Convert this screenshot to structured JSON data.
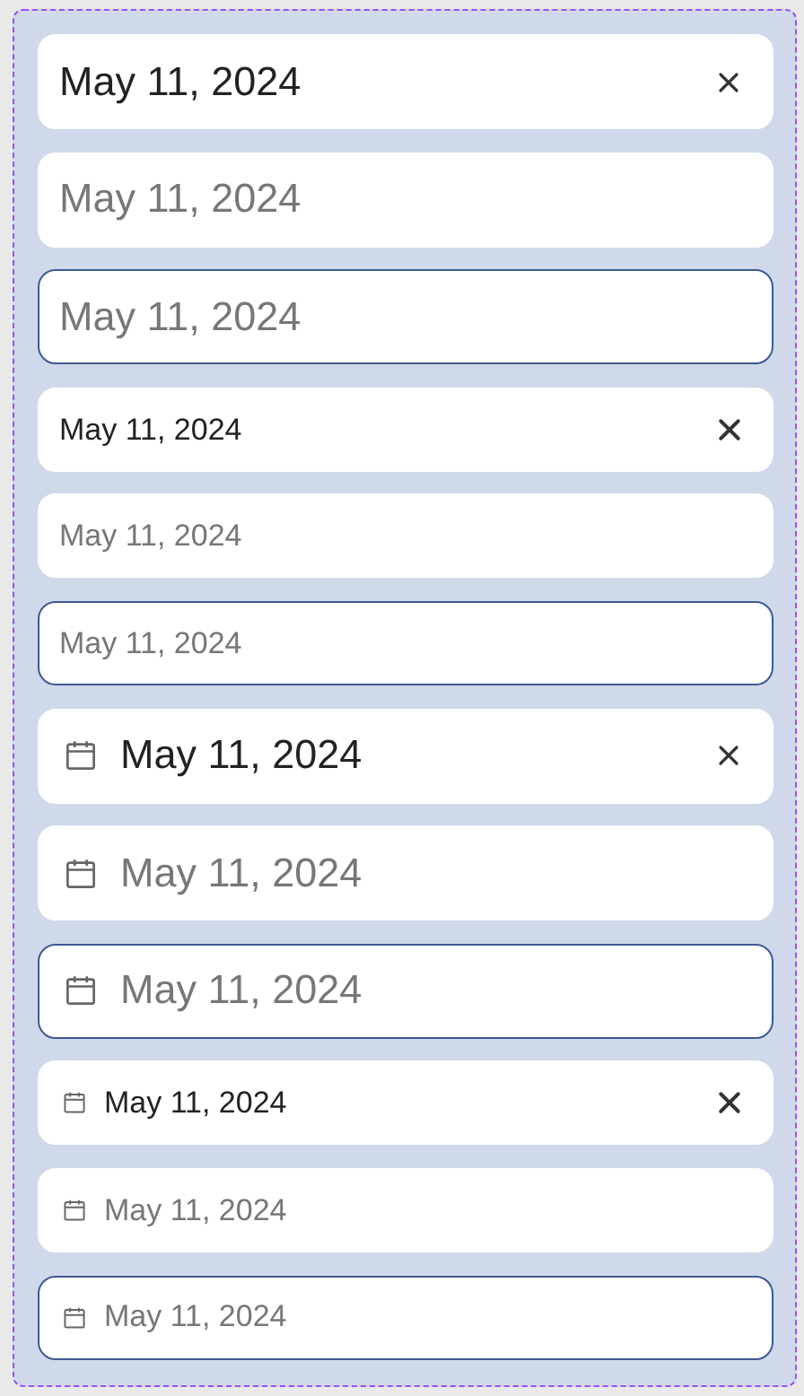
{
  "fields": [
    {
      "kind": "large",
      "icon": false,
      "value": "May 11, 2024",
      "focused": false
    },
    {
      "kind": "large",
      "icon": false,
      "placeholder": "May 11, 2024",
      "focused": false
    },
    {
      "kind": "large",
      "icon": false,
      "placeholder": "May 11, 2024",
      "focused": true
    },
    {
      "kind": "small",
      "icon": false,
      "value": "May 11, 2024",
      "focused": false
    },
    {
      "kind": "small",
      "icon": false,
      "placeholder": "May 11, 2024",
      "focused": false
    },
    {
      "kind": "small",
      "icon": false,
      "placeholder": "May 11, 2024",
      "focused": true
    },
    {
      "kind": "large",
      "icon": true,
      "value": "May 11, 2024",
      "focused": false
    },
    {
      "kind": "large",
      "icon": true,
      "placeholder": "May 11, 2024",
      "focused": false
    },
    {
      "kind": "large",
      "icon": true,
      "placeholder": "May 11, 2024",
      "focused": true
    },
    {
      "kind": "small",
      "icon": true,
      "value": "May 11, 2024",
      "focused": false
    },
    {
      "kind": "small",
      "icon": true,
      "placeholder": "May 11, 2024",
      "focused": false
    },
    {
      "kind": "small",
      "icon": true,
      "placeholder": "May 11, 2024",
      "focused": true
    }
  ]
}
